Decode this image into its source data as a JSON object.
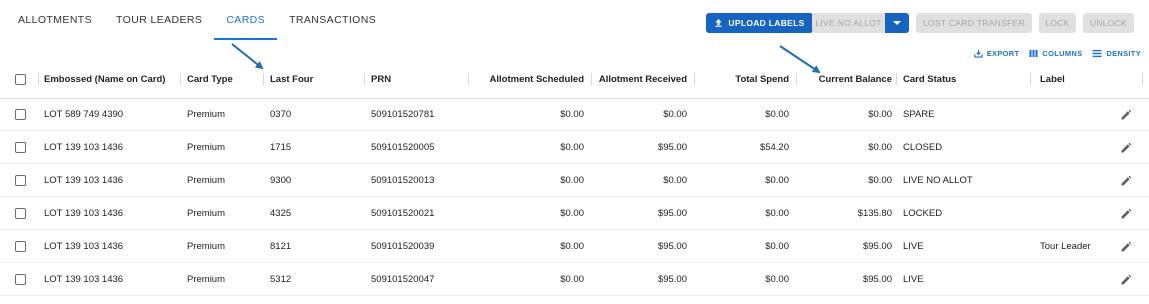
{
  "tabs": [
    {
      "label": "ALLOTMENTS",
      "active": false
    },
    {
      "label": "TOUR LEADERS",
      "active": false
    },
    {
      "label": "CARDS",
      "active": true
    },
    {
      "label": "TRANSACTIONS",
      "active": false
    }
  ],
  "toolbar": {
    "upload_labels": "UPLOAD LABELS",
    "live_no_allot": "LIVE NO ALLOT",
    "lost_card_transfer": "LOST CARD TRANSFER",
    "lock": "LOCK",
    "unlock": "UNLOCK"
  },
  "grid_toolbar": {
    "export": "EXPORT",
    "columns": "COLUMNS",
    "density": "DENSITY"
  },
  "columns": {
    "embossed": "Embossed (Name on Card)",
    "card_type": "Card Type",
    "last_four": "Last Four",
    "prn": "PRN",
    "allotment_scheduled": "Allotment Scheduled",
    "allotment_received": "Allotment Received",
    "total_spend": "Total Spend",
    "current_balance": "Current Balance",
    "card_status": "Card Status",
    "label": "Label"
  },
  "rows": [
    {
      "embossed": "LOT 589 749 4390",
      "card_type": "Premium",
      "last_four": "0370",
      "prn": "509101520781",
      "allotment_scheduled": "$0.00",
      "allotment_received": "$0.00",
      "total_spend": "$0.00",
      "current_balance": "$0.00",
      "card_status": "SPARE",
      "label": ""
    },
    {
      "embossed": "LOT 139 103 1436",
      "card_type": "Premium",
      "last_four": "1715",
      "prn": "509101520005",
      "allotment_scheduled": "$0.00",
      "allotment_received": "$95.00",
      "total_spend": "$54.20",
      "current_balance": "$0.00",
      "card_status": "CLOSED",
      "label": ""
    },
    {
      "embossed": "LOT 139 103 1436",
      "card_type": "Premium",
      "last_four": "9300",
      "prn": "509101520013",
      "allotment_scheduled": "$0.00",
      "allotment_received": "$0.00",
      "total_spend": "$0.00",
      "current_balance": "$0.00",
      "card_status": "LIVE NO ALLOT",
      "label": ""
    },
    {
      "embossed": "LOT 139 103 1436",
      "card_type": "Premium",
      "last_four": "4325",
      "prn": "509101520021",
      "allotment_scheduled": "$0.00",
      "allotment_received": "$95.00",
      "total_spend": "$0.00",
      "current_balance": "$135.80",
      "card_status": "LOCKED",
      "label": ""
    },
    {
      "embossed": "LOT 139 103 1436",
      "card_type": "Premium",
      "last_four": "8121",
      "prn": "509101520039",
      "allotment_scheduled": "$0.00",
      "allotment_received": "$95.00",
      "total_spend": "$0.00",
      "current_balance": "$95.00",
      "card_status": "LIVE",
      "label": "Tour Leader"
    },
    {
      "embossed": "LOT 139 103 1436",
      "card_type": "Premium",
      "last_four": "5312",
      "prn": "509101520047",
      "allotment_scheduled": "$0.00",
      "allotment_received": "$95.00",
      "total_spend": "$0.00",
      "current_balance": "$95.00",
      "card_status": "LIVE",
      "label": ""
    }
  ],
  "icons": {
    "upload": "upload-icon",
    "dropdown": "chevron-down-icon",
    "export": "export-icon",
    "columns": "columns-icon",
    "density": "density-icon",
    "edit": "pencil-icon",
    "annotation": "arrow-annotation"
  },
  "colors": {
    "accent": "#1976d2",
    "primary_button": "#1565c0",
    "disabled_button": "#e0e0e0",
    "annotation_arrow": "#1f6fb2"
  }
}
